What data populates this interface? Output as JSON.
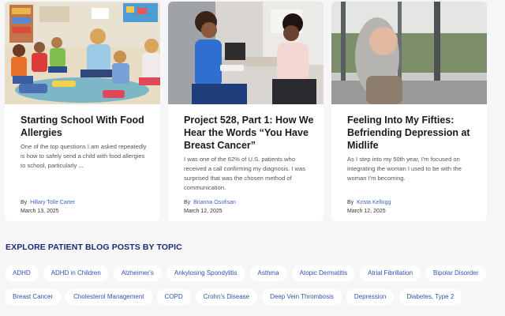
{
  "cards": [
    {
      "image": "classroom-children-sitting-in-circle-photo",
      "title": "Starting School With Food Allergies",
      "excerpt": "One of the top questions I am asked repeatedly is how to safely send a child with food allergies to school, particularly ...",
      "by_label": "By",
      "author": "Hillary Tolle Carter",
      "date": "March 13, 2025"
    },
    {
      "image": "doctor-consulting-patient-photo",
      "title": "Project 528, Part 1: How We Hear the Words “You Have Breast Cancer”",
      "excerpt": "I was one of the 62% of U.S. patients who received a call confirming my diagnosis. I was surprised that was the chosen method of communication.",
      "by_label": "By",
      "author": "Brianna Osofisan",
      "date": "March 12, 2025"
    },
    {
      "image": "woman-looking-out-window-photo",
      "title": "Feeling Into My Fifties: Befriending Depression at Midlife",
      "excerpt": "As I step into my 50th year, I'm focused on integrating the woman I used to be with the woman I'm becoming.",
      "by_label": "By",
      "author": "Krista Kellogg",
      "date": "March 12, 2025"
    }
  ],
  "topics_heading": "EXPLORE PATIENT BLOG POSTS BY TOPIC",
  "topics": [
    "ADHD",
    "ADHD in Children",
    "Alzheimer's",
    "Ankylosing Spondylitis",
    "Asthma",
    "Atopic Dermatitis",
    "Atrial Fibrillation",
    "Bipolar Disorder",
    "Breast Cancer",
    "Cholesterol Management",
    "COPD",
    "Crohn's Disease",
    "Deep Vein Thrombosis",
    "Depression",
    "Diabetes, Type 2"
  ]
}
